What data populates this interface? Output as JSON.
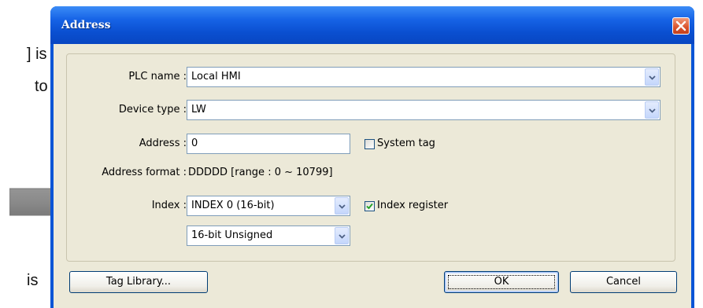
{
  "background_text": {
    "line1": "] is",
    "line2": "to",
    "line3": "is"
  },
  "dialog": {
    "title": "Address",
    "fields": {
      "plc_name": {
        "label": "PLC name :",
        "value": "Local HMI"
      },
      "device_type": {
        "label": "Device type :",
        "value": "LW"
      },
      "address": {
        "label": "Address :",
        "value": "0"
      },
      "system_tag": {
        "label": "System tag",
        "checked": false
      },
      "address_format": {
        "label": "Address format :",
        "value": "DDDDD [range : 0 ~ 10799]"
      },
      "index": {
        "label": "Index :",
        "value": "INDEX 0 (16-bit)"
      },
      "index_register": {
        "label": "Index register",
        "checked": true
      },
      "data_format": {
        "value": "16-bit Unsigned"
      }
    },
    "buttons": {
      "tag_library": "Tag Library...",
      "ok": "OK",
      "cancel": "Cancel"
    }
  },
  "colors": {
    "titlebar": "#0a55d6",
    "client": "#ece9d8",
    "close": "#d9522c",
    "check": "#21a121"
  },
  "icons": {
    "close": "close-icon",
    "dropdown": "chevron-down-icon",
    "checkmark": "checkmark-icon",
    "arrow": "right-arrow-icon"
  }
}
